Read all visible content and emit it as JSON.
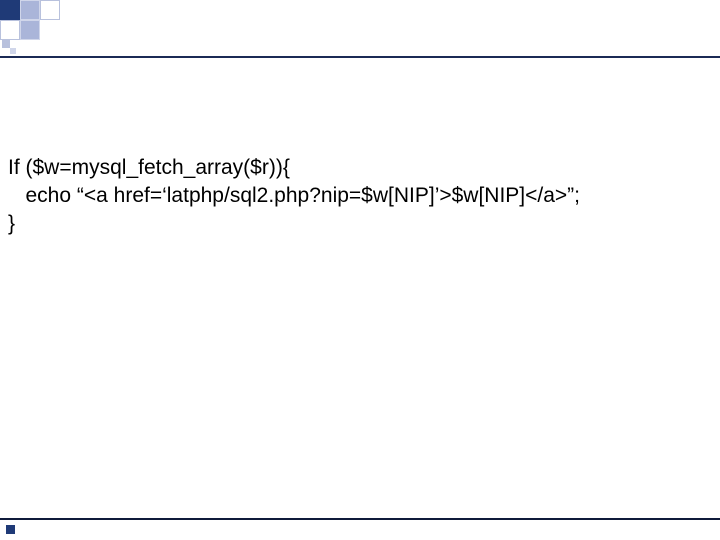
{
  "code": {
    "lines": [
      "If ($w=mysql_fetch_array($r)){",
      "   echo “<a href=‘latphp/sql2.php?nip=$w[NIP]’>$w[NIP]</a>”;",
      "}"
    ]
  }
}
